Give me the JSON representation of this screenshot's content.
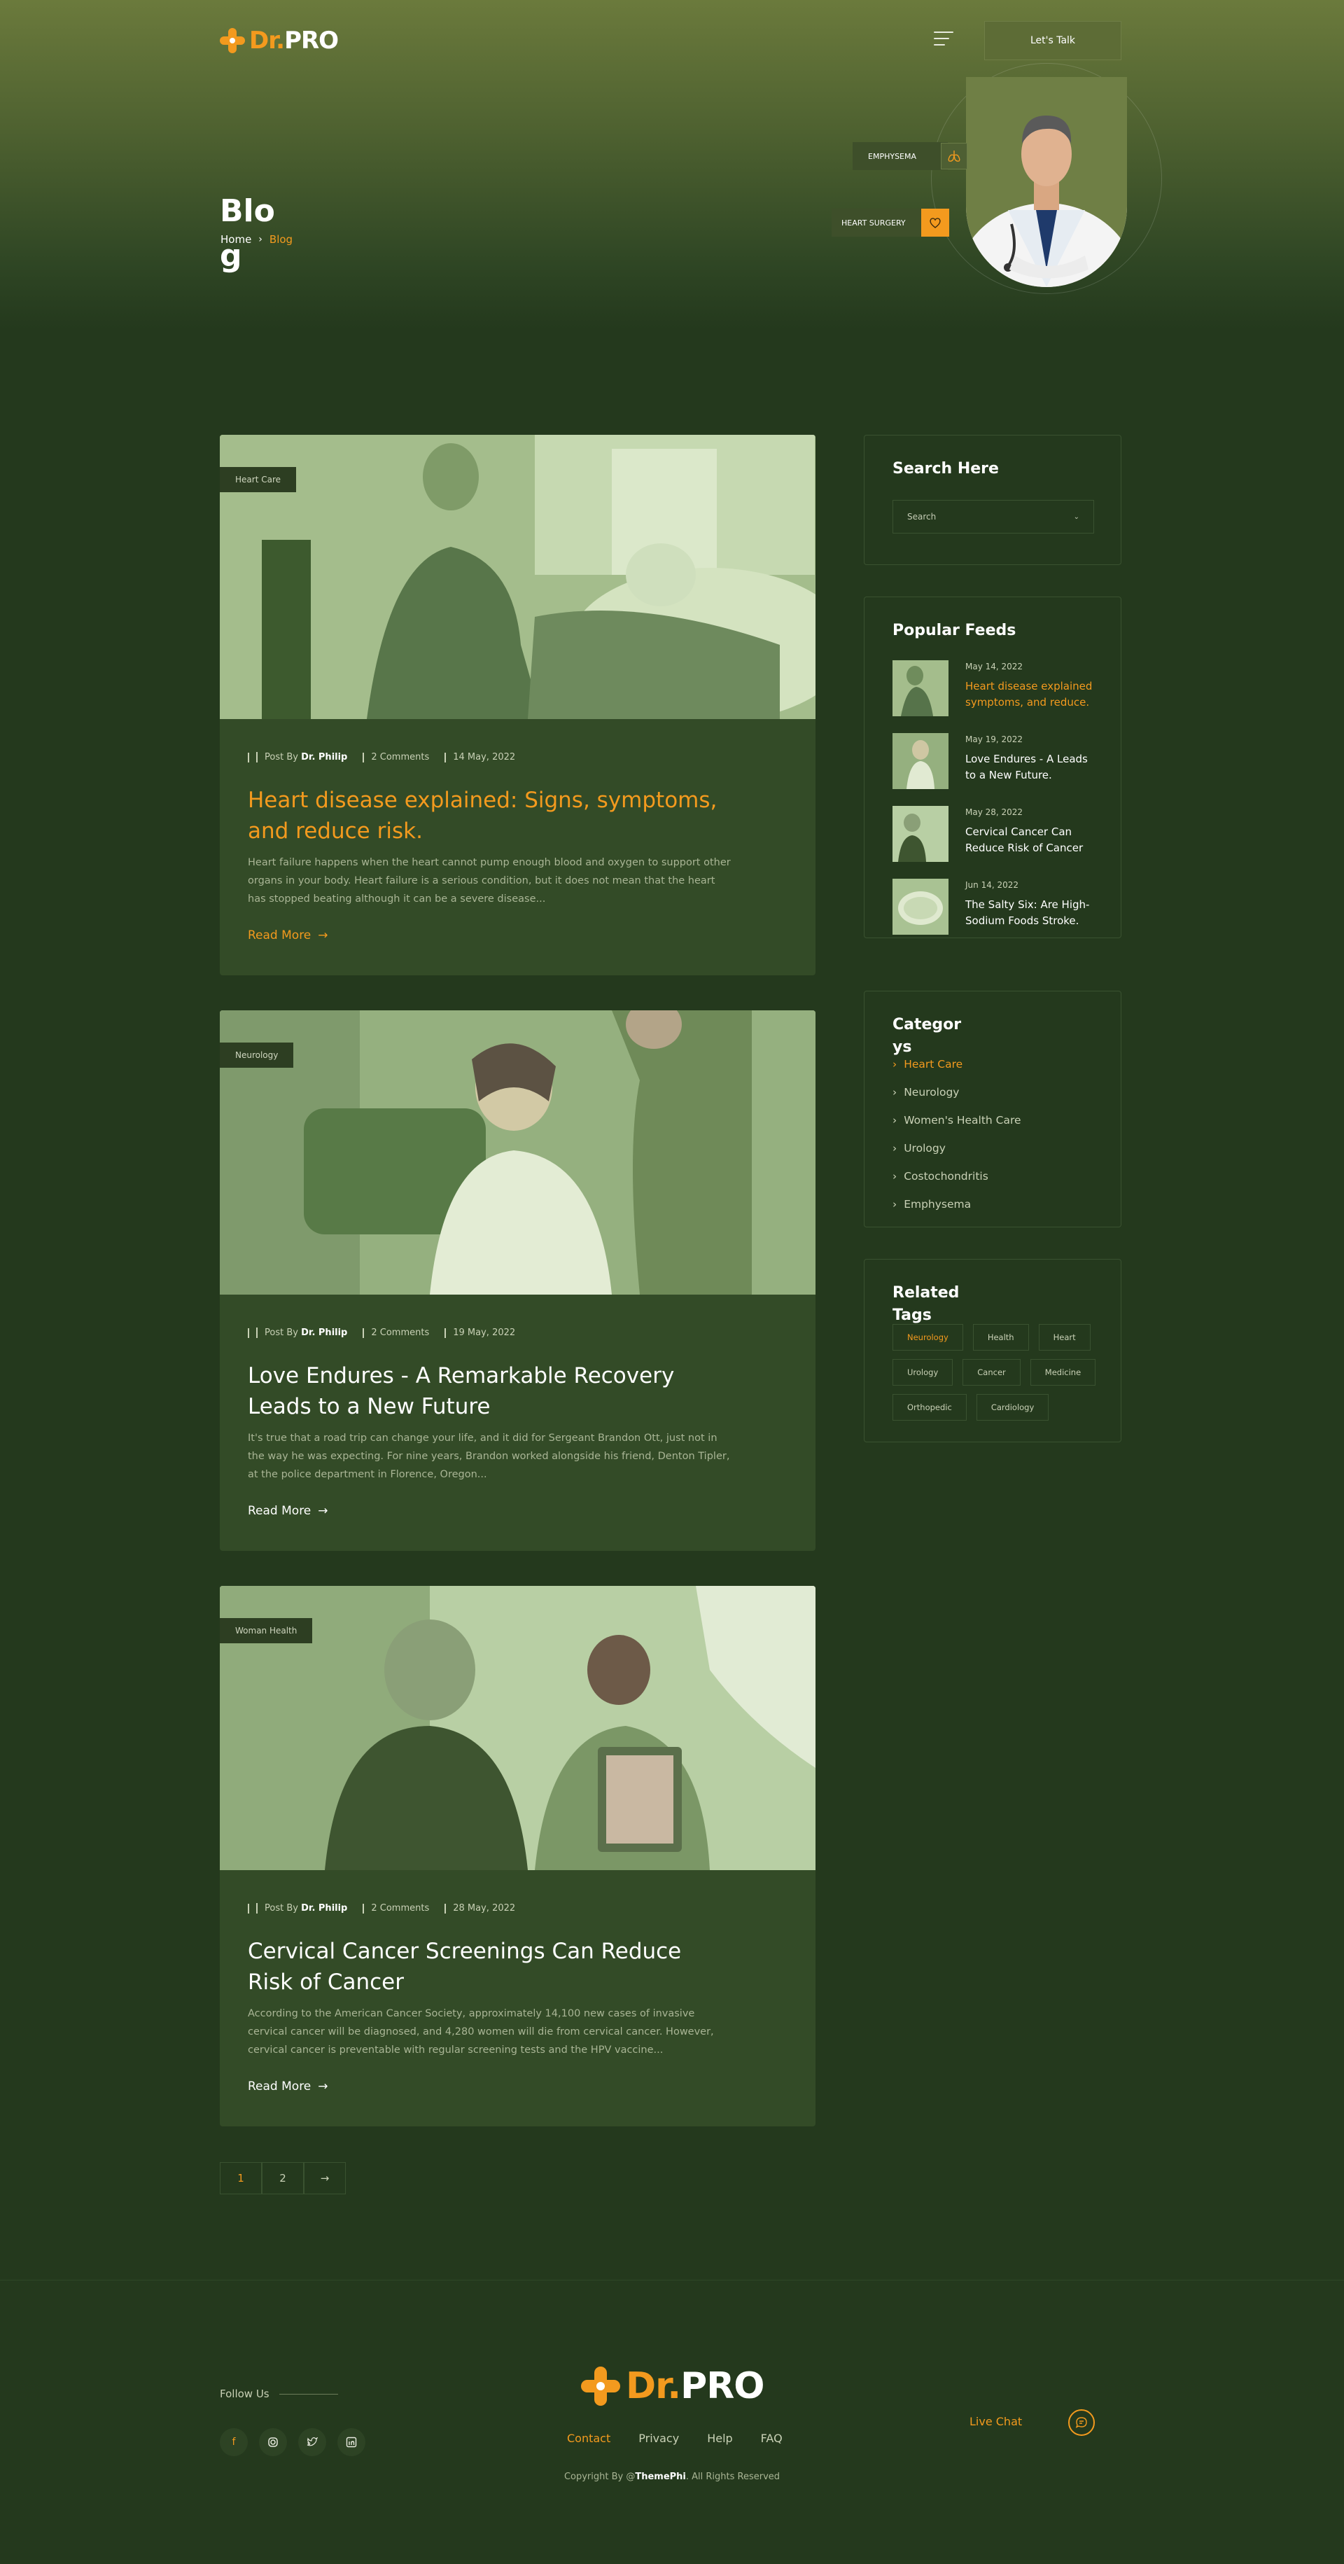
{
  "brand": {
    "prefix": "Dr.",
    "suffix": "PRO"
  },
  "header": {
    "cta_label": "Let's Talk"
  },
  "hero": {
    "title": "Blog",
    "breadcrumb": {
      "home": "Home",
      "separator": "›",
      "current": "Blog"
    },
    "tags": [
      {
        "label": "EMPHYSEMA",
        "icon": "lungs-icon"
      },
      {
        "label": "HEART SURGERY",
        "icon": "heart-icon"
      }
    ]
  },
  "posts": [
    {
      "category": "Heart Care",
      "author_prefix": "Post By",
      "author": "Dr. Philip",
      "comments": "2 Comments",
      "date": "14 May, 2022",
      "title": "Heart disease explained: Signs, symptoms, and reduce risk.",
      "excerpt": "Heart failure happens when the heart cannot pump enough blood and oxygen to support other organs in your body. Heart failure is a serious condition, but it does not mean that the heart has stopped beating although it can be a severe disease...",
      "read_more": "Read More"
    },
    {
      "category": "Neurology",
      "author_prefix": "Post By",
      "author": "Dr. Philip",
      "comments": "2 Comments",
      "date": "19 May, 2022",
      "title": "Love Endures - A Remarkable Recovery Leads to a New Future",
      "excerpt": "It's true that a road trip can change your life, and it did for Sergeant Brandon Ott, just not in the way he was expecting. For nine years, Brandon worked alongside his friend, Denton Tipler, at the police department in Florence, Oregon...",
      "read_more": "Read More"
    },
    {
      "category": "Woman Health",
      "author_prefix": "Post By",
      "author": "Dr. Philip",
      "comments": "2 Comments",
      "date": "28 May, 2022",
      "title": "Cervical Cancer Screenings Can Reduce Risk of Cancer",
      "excerpt": "According to the American Cancer Society, approximately 14,100 new cases of invasive cervical cancer will be diagnosed, and 4,280 women will die from cervical cancer. However, cervical cancer is preventable with regular screening tests and the HPV vaccine...",
      "read_more": "Read More"
    }
  ],
  "pagination": {
    "pages": [
      "1",
      "2"
    ],
    "next": "→"
  },
  "sidebar": {
    "search": {
      "title": "Search Here",
      "placeholder": "Search"
    },
    "feeds": {
      "title": "Popular Feeds",
      "items": [
        {
          "date": "May 14, 2022",
          "title": "Heart disease explained symptoms, and reduce."
        },
        {
          "date": "May 19, 2022",
          "title": "Love Endures - A Leads to a New Future."
        },
        {
          "date": "May 28, 2022",
          "title": "Cervical Cancer Can Reduce Risk of Cancer"
        },
        {
          "date": "Jun 14, 2022",
          "title": "The Salty Six: Are High-Sodium Foods Stroke."
        }
      ]
    },
    "categories": {
      "title": "Categorys",
      "items": [
        "Heart Care",
        "Neurology",
        "Women's Health Care",
        "Urology",
        "Costochondritis",
        "Emphysema"
      ]
    },
    "tags": {
      "title": "Related Tags",
      "items": [
        "Neurology",
        "Health",
        "Heart",
        "Urology",
        "Cancer",
        "Medicine",
        "Orthopedic",
        "Cardiology"
      ]
    }
  },
  "footer": {
    "follow_label": "Follow Us",
    "socials": [
      "facebook-icon",
      "instagram-icon",
      "twitter-icon",
      "linkedin-icon"
    ],
    "links": [
      "Contact",
      "Privacy",
      "Help",
      "FAQ"
    ],
    "copyright_prefix": "Copyright By @",
    "copyright_brand": "ThemePhi",
    "copyright_suffix": ". All Rights Reserved",
    "live_chat": "Live Chat"
  },
  "colors": {
    "accent": "#f39a1e",
    "background": "#24391d",
    "card": "#334b27"
  }
}
